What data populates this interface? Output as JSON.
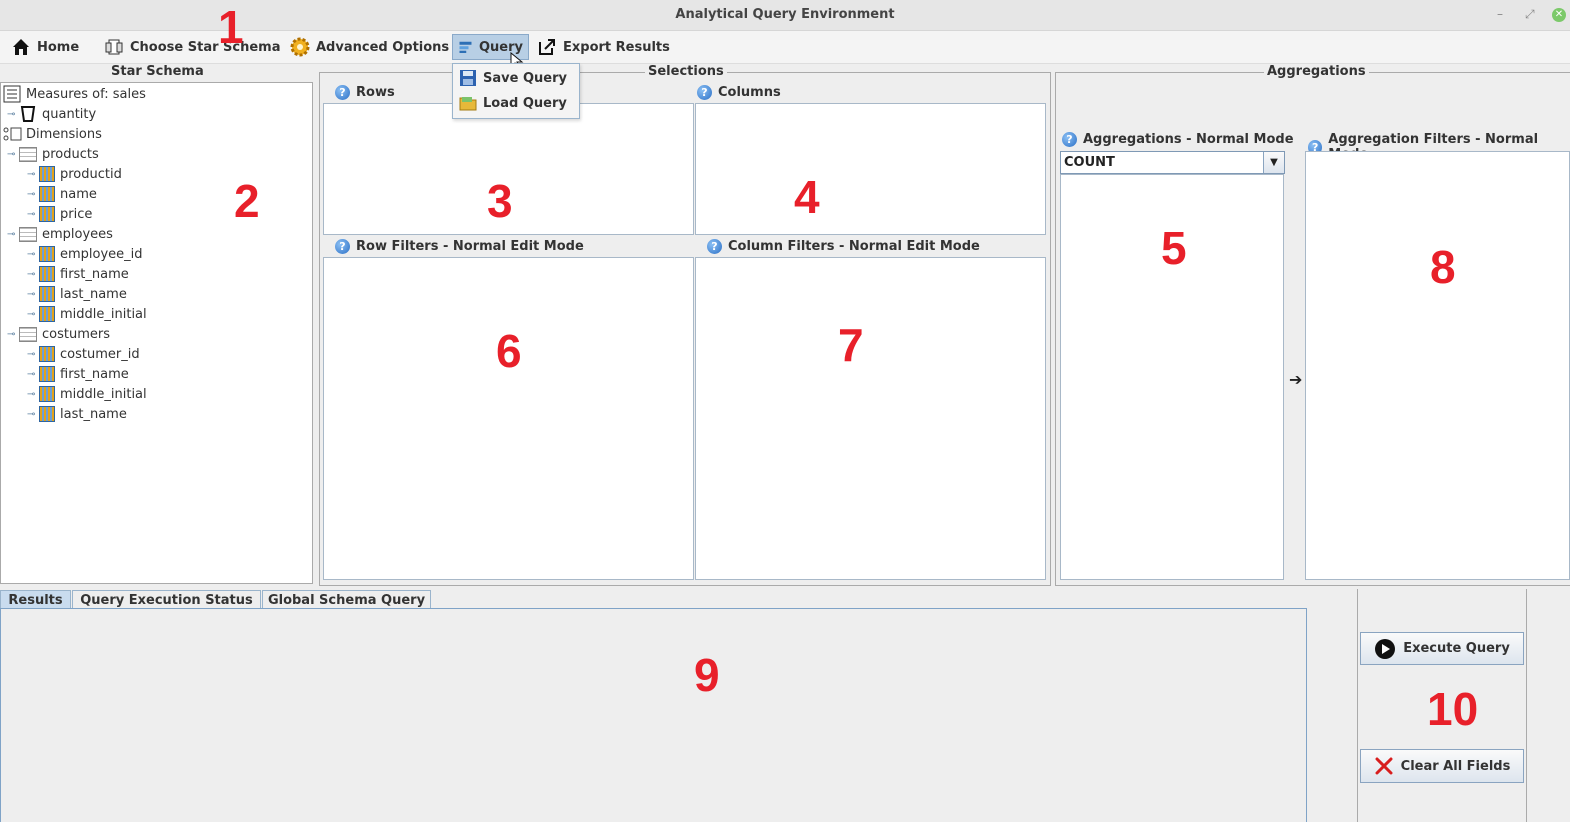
{
  "window": {
    "title": "Analytical Query Environment"
  },
  "menubar": {
    "home": "Home",
    "choose_star_schema": "Choose Star Schema",
    "advanced_options": "Advanced Options",
    "query": "Query",
    "export_results": "Export Results"
  },
  "query_menu": {
    "save": "Save Query",
    "load": "Load Query"
  },
  "star_schema": {
    "title": "Star Schema",
    "measures_label": "Measures of: sales",
    "measures": [
      "quantity"
    ],
    "dimensions_label": "Dimensions",
    "tables": [
      {
        "name": "products",
        "fields": [
          "productid",
          "name",
          "price"
        ]
      },
      {
        "name": "employees",
        "fields": [
          "employee_id",
          "first_name",
          "last_name",
          "middle_initial"
        ]
      },
      {
        "name": "costumers",
        "fields": [
          "costumer_id",
          "first_name",
          "middle_initial",
          "last_name"
        ]
      }
    ]
  },
  "selections": {
    "title": "Selections",
    "rows": "Rows",
    "columns": "Columns",
    "row_filters": "Row Filters - Normal Edit Mode",
    "column_filters": "Column Filters - Normal Edit Mode"
  },
  "aggregations": {
    "title": "Aggregations",
    "agg_label": "Aggregations - Normal Mode",
    "agg_selected": "COUNT",
    "filters_label": "Aggregation Filters - Normal Mode"
  },
  "tabs": [
    "Results",
    "Query Execution  Status",
    "Global Schema Query"
  ],
  "buttons": {
    "execute": "Execute Query",
    "clear": "Clear All Fields"
  },
  "annotations": [
    "1",
    "2",
    "3",
    "4",
    "5",
    "6",
    "7",
    "8",
    "9",
    "10"
  ],
  "colors": {
    "annotation": "#e8202a",
    "menu_active": "#b8cfe5",
    "tab_selected": "#c9dcef"
  }
}
